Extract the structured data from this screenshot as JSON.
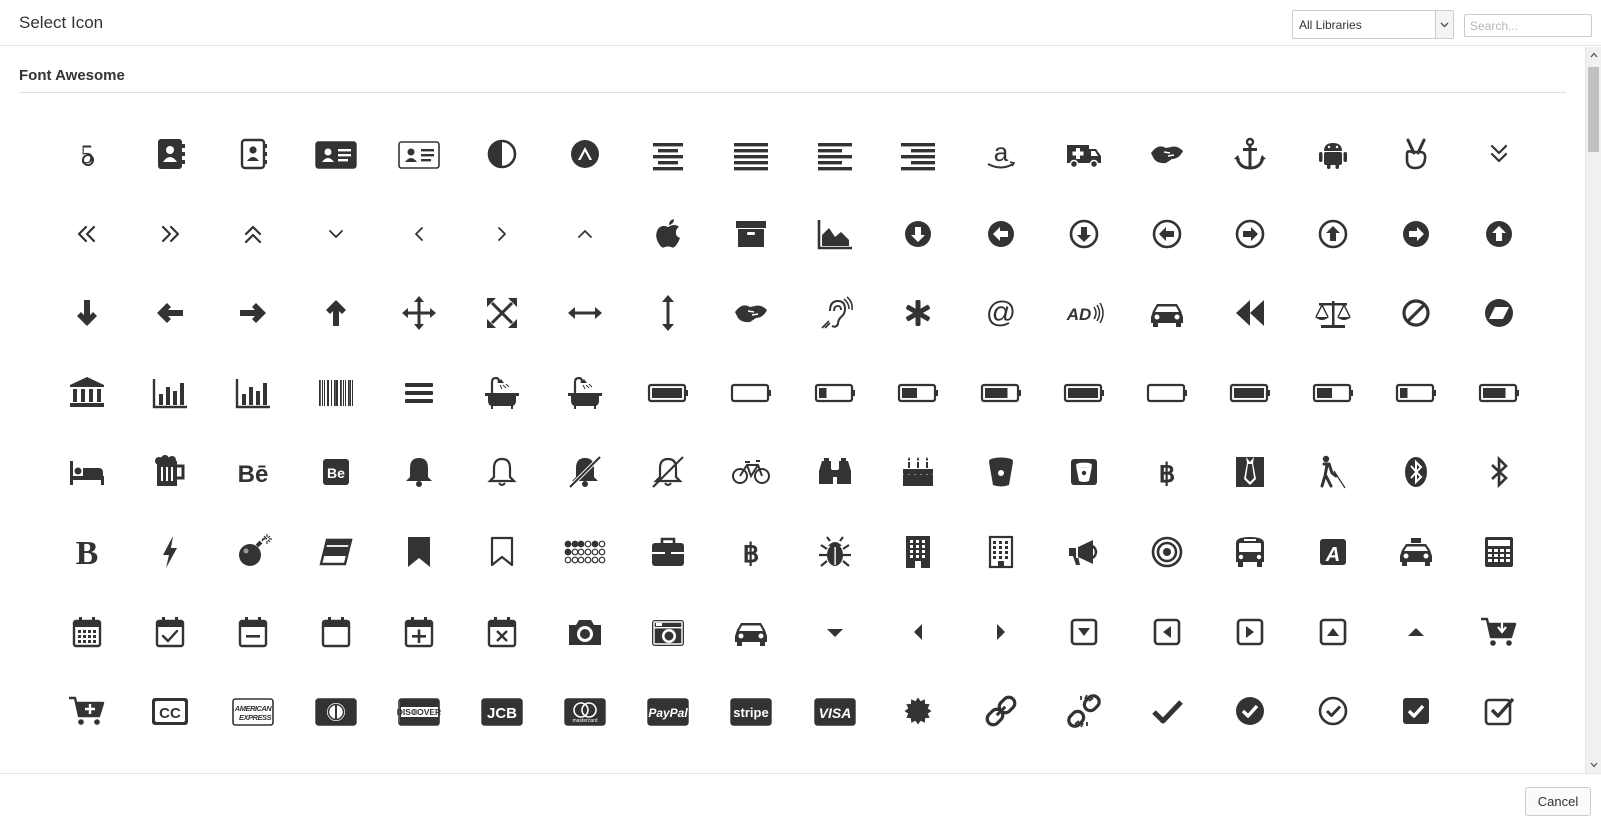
{
  "dialog": {
    "title": "Select Icon"
  },
  "library_select": {
    "value": "All Libraries"
  },
  "search": {
    "placeholder": "Search..."
  },
  "section": {
    "title": "Font Awesome"
  },
  "footer": {
    "cancel_label": "Cancel"
  },
  "icons": [
    "500px-icon",
    "address-book-icon",
    "address-book-o-icon",
    "address-card-icon",
    "address-card-o-icon",
    "adjust-icon",
    "adn-icon",
    "align-center-icon",
    "align-justify-icon",
    "align-left-icon",
    "align-right-icon",
    "amazon-icon",
    "ambulance-icon",
    "american-sign-language-interpreting-icon",
    "anchor-icon",
    "android-icon",
    "angellist-icon",
    "angle-double-down-icon",
    "angle-double-left-icon",
    "angle-double-right-icon",
    "angle-double-up-icon",
    "angle-down-icon",
    "angle-left-icon",
    "angle-right-icon",
    "angle-up-icon",
    "apple-icon",
    "archive-icon",
    "area-chart-icon",
    "arrow-circle-down-icon",
    "arrow-circle-left-icon",
    "arrow-circle-o-down-icon",
    "arrow-circle-o-left-icon",
    "arrow-circle-o-right-icon",
    "arrow-circle-o-up-icon",
    "arrow-circle-right-icon",
    "arrow-circle-up-icon",
    "arrow-down-icon",
    "arrow-left-icon",
    "arrow-right-icon",
    "arrow-up-icon",
    "arrows-icon",
    "arrows-alt-icon",
    "arrows-h-icon",
    "arrows-v-icon",
    "asl-interpreting-icon",
    "assistive-listening-systems-icon",
    "asterisk-icon",
    "at-icon",
    "audio-description-icon",
    "automobile-icon",
    "backward-icon",
    "balance-scale-icon",
    "ban-icon",
    "bandcamp-icon",
    "bank-icon",
    "bar-chart-icon",
    "bar-chart-o-icon",
    "barcode-icon",
    "bars-icon",
    "bath-icon",
    "bathtub-icon",
    "battery-icon",
    "battery-0-icon",
    "battery-1-icon",
    "battery-2-icon",
    "battery-3-icon",
    "battery-4-icon",
    "battery-empty-icon",
    "battery-full-icon",
    "battery-half-icon",
    "battery-quarter-icon",
    "battery-three-quarters-icon",
    "bed-icon",
    "beer-icon",
    "behance-icon",
    "behance-square-icon",
    "bell-icon",
    "bell-o-icon",
    "bell-slash-icon",
    "bell-slash-o-icon",
    "bicycle-icon",
    "binoculars-icon",
    "birthday-cake-icon",
    "bitbucket-icon",
    "bitbucket-square-icon",
    "bitcoin-icon",
    "black-tie-icon",
    "blind-icon",
    "bluetooth-icon",
    "bluetooth-b-icon",
    "bold-icon",
    "bolt-icon",
    "bomb-icon",
    "book-icon",
    "bookmark-icon",
    "bookmark-o-icon",
    "braille-icon",
    "briefcase-icon",
    "btc-icon",
    "bug-icon",
    "building-icon",
    "building-o-icon",
    "bullhorn-icon",
    "bullseye-icon",
    "bus-icon",
    "buysellads-icon",
    "cab-icon",
    "calculator-icon",
    "calendar-icon",
    "calendar-check-o-icon",
    "calendar-minus-o-icon",
    "calendar-o-icon",
    "calendar-plus-o-icon",
    "calendar-times-o-icon",
    "camera-icon",
    "camera-retro-icon",
    "car-icon",
    "caret-down-icon",
    "caret-left-icon",
    "caret-right-icon",
    "caret-square-o-down-icon",
    "caret-square-o-left-icon",
    "caret-square-o-right-icon",
    "caret-square-o-up-icon",
    "caret-up-icon",
    "cart-arrow-down-icon",
    "cart-plus-icon",
    "cc-icon",
    "cc-amex-icon",
    "cc-diners-club-icon",
    "cc-discover-icon",
    "cc-jcb-icon",
    "cc-mastercard-icon",
    "cc-paypal-icon",
    "cc-stripe-icon",
    "cc-visa-icon",
    "certificate-icon",
    "chain-icon",
    "chain-broken-icon",
    "check-icon",
    "check-circle-icon",
    "check-circle-o-icon",
    "check-square-icon",
    "check-square-o-icon"
  ],
  "card_labels": {
    "amex_top": "AMERICAN",
    "amex_bottom": "EXPRESS",
    "discover": "DISCOVER",
    "jcb": "JCB",
    "mastercard": "mastercard",
    "paypal": "PayPal",
    "stripe": "stripe",
    "visa": "VISA",
    "cc": "CC",
    "behance": "Bē",
    "behance_square": "Be",
    "bold": "B",
    "buysellads": "A",
    "audio_description": "AD",
    "at": "@",
    "five_hundred": "5"
  },
  "colors": {
    "icon": "#333333",
    "accent_border": "#cccccc"
  }
}
